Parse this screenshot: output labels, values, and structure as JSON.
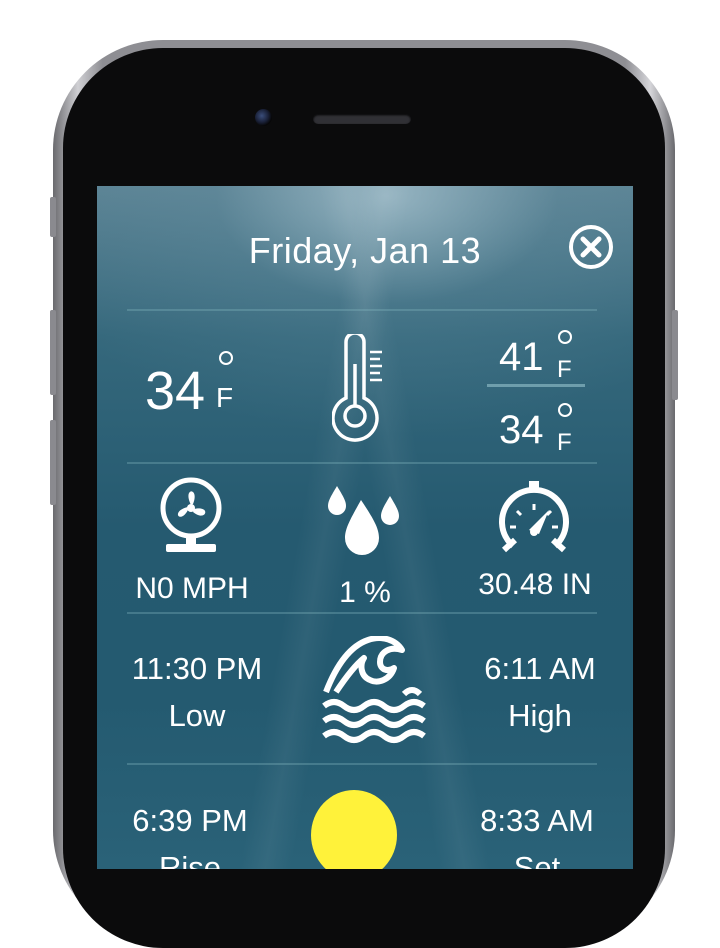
{
  "header": {
    "date": "Friday, Jan 13",
    "close_icon": "close-circle-icon"
  },
  "temperature": {
    "current": "34",
    "current_unit": "F",
    "high": "41",
    "high_unit": "F",
    "low": "34",
    "low_unit": "F",
    "icon": "thermometer-icon"
  },
  "conditions": {
    "wind": "N0 MPH",
    "wind_icon": "fan-icon",
    "precipitation": "1 %",
    "precipitation_icon": "raindrops-icon",
    "pressure": "30.48 IN",
    "pressure_icon": "gauge-icon"
  },
  "tides": {
    "left_time": "11:30 PM",
    "left_label": "Low",
    "right_time": "6:11 AM",
    "right_label": "High",
    "icon": "waves-icon"
  },
  "sun": {
    "left_time": "6:39 PM",
    "left_label": "Rise",
    "right_time": "8:33 AM",
    "right_label": "Set",
    "icon": "sun-icon",
    "sun_color": "#fff23a"
  },
  "colors": {
    "screen_bg": "#255a70",
    "text": "#ffffff"
  }
}
